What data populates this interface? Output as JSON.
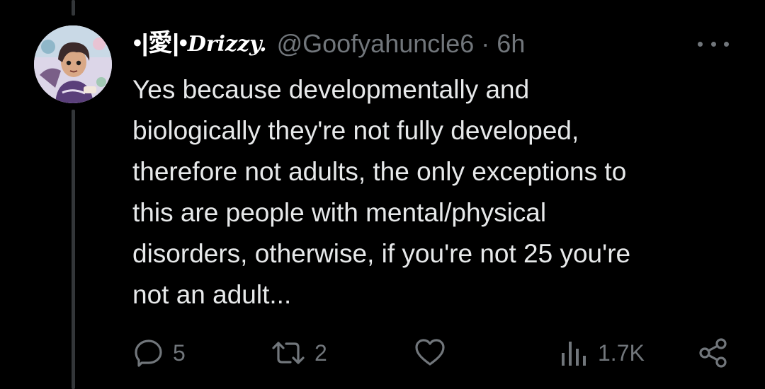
{
  "tweet": {
    "display_name_prefix": "•|愛|•",
    "display_name_fancy": "Drizzy.",
    "handle": "@Goofyahuncle6",
    "separator": "·",
    "time": "6h",
    "text": "Yes because developmentally and\nbiologically they're not fully developed,\ntherefore not adults, the only exceptions to\nthis are people with mental/physical\ndisorders, otherwise, if you're not 25 you're\nnot an adult..."
  },
  "actions": {
    "reply_count": "5",
    "retweet_count": "2",
    "like_count": "",
    "views_count": "1.7K"
  },
  "colors": {
    "background": "#000000",
    "text": "#e7e9ea",
    "muted": "#71767b",
    "thread_line": "#333639"
  },
  "icons": [
    "more-icon",
    "reply-icon",
    "retweet-icon",
    "like-icon",
    "views-icon",
    "share-icon"
  ]
}
